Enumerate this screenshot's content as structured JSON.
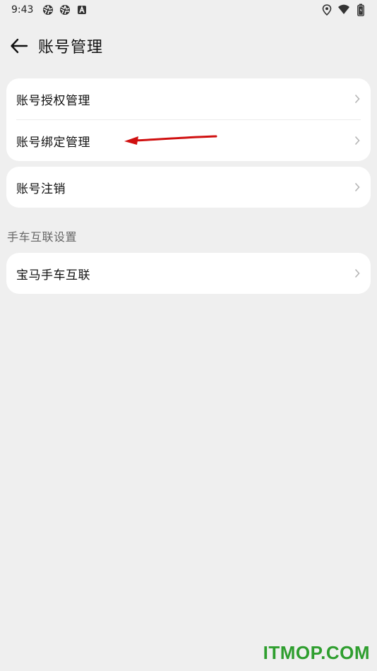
{
  "status_bar": {
    "time": "9:43",
    "left_icons": [
      "aperture-icon",
      "aperture-icon",
      "a-badge-icon"
    ],
    "right_icons": [
      "location-icon",
      "wifi-icon",
      "battery-icon"
    ]
  },
  "header": {
    "title": "账号管理",
    "back_icon": "arrow-left-icon"
  },
  "groups": [
    {
      "items": [
        {
          "label": "账号授权管理"
        },
        {
          "label": "账号绑定管理"
        }
      ]
    },
    {
      "items": [
        {
          "label": "账号注销"
        }
      ]
    }
  ],
  "section": {
    "label": "手车互联设置",
    "items": [
      {
        "label": "宝马手车互联"
      }
    ]
  },
  "annotation": {
    "color": "#d01010"
  },
  "watermark": {
    "text": "ITMOP.COM",
    "color": "#2e9e2e"
  }
}
